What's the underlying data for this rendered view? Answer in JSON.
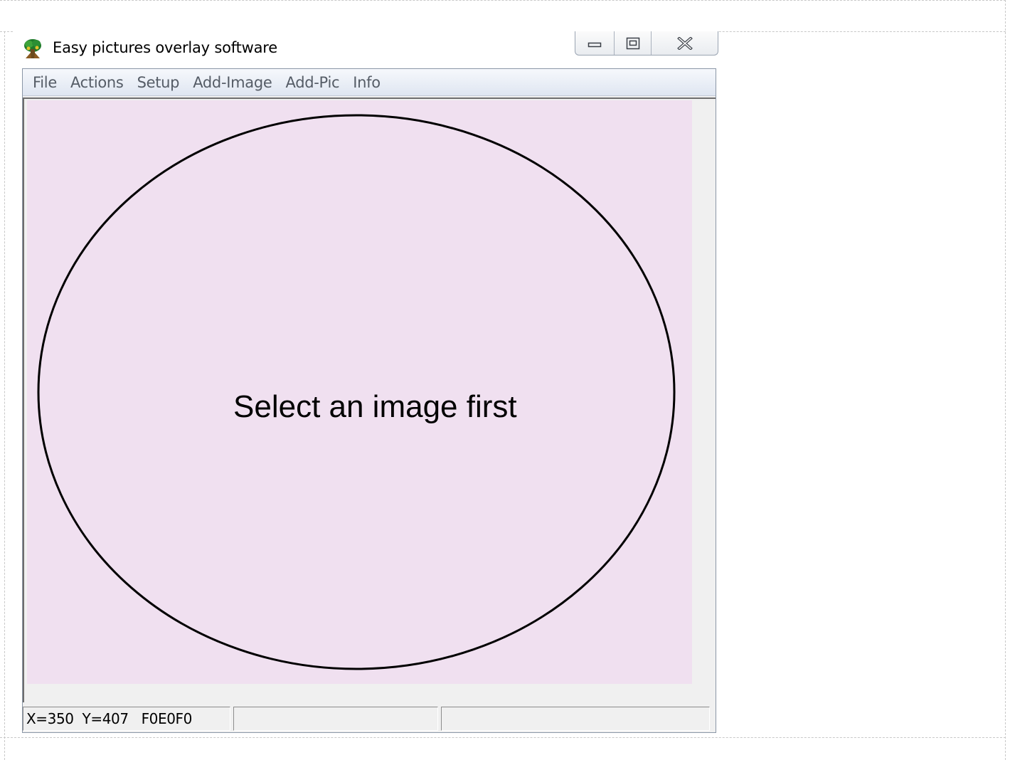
{
  "window": {
    "title": "Easy pictures overlay software",
    "icon": "tree-icon"
  },
  "caption_buttons": {
    "minimize_icon": "minimize-icon",
    "maximize_icon": "restore-icon",
    "close_icon": "close-icon"
  },
  "menu": {
    "items": [
      {
        "label": "File"
      },
      {
        "label": "Actions"
      },
      {
        "label": "Setup"
      },
      {
        "label": "Add-Image"
      },
      {
        "label": "Add-Pic"
      },
      {
        "label": "Info"
      }
    ]
  },
  "canvas": {
    "message": "Select an image first",
    "background_color": "#F0E0F0",
    "shape": "ellipse"
  },
  "status": {
    "panels": [
      {
        "text": "X=350  Y=407   F0E0F0"
      },
      {
        "text": ""
      },
      {
        "text": ""
      }
    ]
  }
}
